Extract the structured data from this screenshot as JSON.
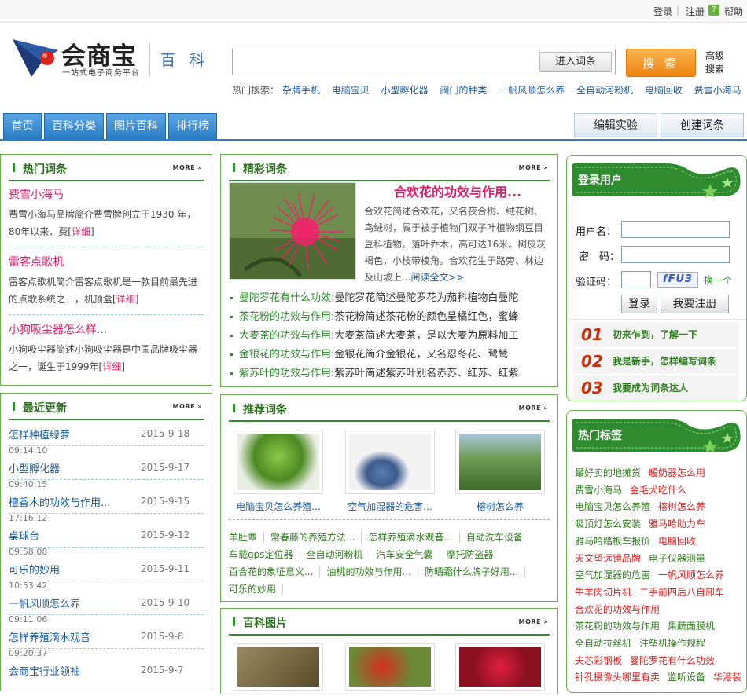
{
  "topbar": {
    "login": "登录",
    "register": "注册",
    "help": "帮助"
  },
  "logo": {
    "name": "会商宝",
    "slogan": "一站式电子商务平台",
    "section": "百 科"
  },
  "search": {
    "placeholder": "",
    "enter_label": "进入词条",
    "search_label": "搜 索",
    "advanced_label": "高级搜索"
  },
  "hot_search": {
    "label": "热门搜索：",
    "items": [
      "杂牌手机",
      "电脑宝贝",
      "小型孵化器",
      "阀门的种类",
      "一帆风顺怎么养",
      "全自动河粉机",
      "电脑回收",
      "费雪小海马"
    ]
  },
  "nav": {
    "tabs": [
      "首页",
      "百科分类",
      "图片百科",
      "排行榜"
    ],
    "right": [
      "编辑实验",
      "创建词条"
    ]
  },
  "more": "MORE",
  "hot_entries": {
    "title": "热门词条",
    "items": [
      {
        "title": "费雪小海马",
        "desc": "费雪小海马品牌简介费雪牌创立于1930 年，80年以来，费[",
        "detail": "详细",
        "tail": "]"
      },
      {
        "title": "雷客点歌机",
        "desc": "雷客点歌机简介雷客点歌机是一款目前最先进的点歌系统之一，机顶盒[",
        "detail": "详细",
        "tail": "]"
      },
      {
        "title": "小狗吸尘器怎么样...",
        "desc": "小狗吸尘器简述小狗吸尘器是中国品牌吸尘器之一，诞生于1999年[",
        "detail": "详细",
        "tail": "]"
      }
    ]
  },
  "recent": {
    "title": "最近更新",
    "items": [
      {
        "title": "怎样种植绿萝",
        "date": "2015-9-18",
        "time": ""
      },
      {
        "title": "小型孵化器",
        "date": "2015-9-17",
        "time": "09:14:10"
      },
      {
        "title": "檀香木的功效与作用...",
        "date": "2015-9-15",
        "time": "09:40:15"
      },
      {
        "title": "桌球台",
        "date": "2015-9-12",
        "time": "17:16:12"
      },
      {
        "title": "可乐的妙用",
        "date": "2015-9-11",
        "time": "09:58:08"
      },
      {
        "title": "一帆风顺怎么养",
        "date": "2015-9-10",
        "time": "10:53:42"
      },
      {
        "title": "怎样养殖滴水观音",
        "date": "2015-9-8",
        "time": "09:11:06"
      },
      {
        "title": "会商宝行业领袖",
        "date": "2015-9-7",
        "time": "09:20:37"
      }
    ]
  },
  "featured": {
    "title": "精彩词条",
    "main_title": "合欢花的功效与作用...",
    "main_desc": "合欢花简述合欢花，又名夜合树、绒花树、鸟绒树，属于被子植物门双子叶植物纲豆目豆科植物。落叶乔木，高可达16米。树皮灰褐色，小枝带棱角。合欢花生于路旁、林边及山坡上...",
    "read_more": "阅读全文>>",
    "list": [
      {
        "k": "曼陀罗花有什么功效",
        "v": "曼陀罗花简述曼陀罗花为茄科植物白曼陀"
      },
      {
        "k": "茶花粉的功效与作用",
        "v": "茶花粉简述茶花粉的颜色呈橘红色，蜜蜂"
      },
      {
        "k": "大麦茶的功效与作用",
        "v": "大麦茶简述大麦茶，是以大麦为原料加工"
      },
      {
        "k": "金银花的功效与作用",
        "v": "金银花简介金银花，又名忍冬花、鹭鸶"
      },
      {
        "k": "紫苏叶的功效与作用",
        "v": "紫苏叶简述紫苏叶别名赤苏、红苏、红紫"
      }
    ]
  },
  "recommend": {
    "title": "推荐词条",
    "cards": [
      "电脑宝贝怎么养殖...",
      "空气加湿器的危害...",
      "榕树怎么养"
    ],
    "tags": [
      [
        "羊肚蕈",
        "常春藤的养殖方法...",
        "怎样养殖滴水观音...",
        "自动洗车设备"
      ],
      [
        "车载gps定位器",
        "全自动河粉机",
        "汽车安全气囊",
        "摩托防盗器"
      ],
      [
        "百合花的象征意义...",
        "油桃的功效与作用...",
        "防晒霜什么牌子好用..."
      ],
      [
        "可乐的妙用"
      ]
    ]
  },
  "pictures": {
    "title": "百科图片"
  },
  "login_box": {
    "title": "登录用户",
    "username_label": "用户名：",
    "password_label": "密　码：",
    "captcha_label": "验证码：",
    "captcha_text": "fFU3",
    "refresh_label": "换一个",
    "login_button": "登录",
    "register_button": "我要注册",
    "steps": [
      {
        "no": "01",
        "text": "初来乍到，了解一下"
      },
      {
        "no": "02",
        "text": "我是新手，怎样编写词条"
      },
      {
        "no": "03",
        "text": "我要成为词条达人"
      }
    ]
  },
  "hot_tags": {
    "title": "热门标签",
    "rows": [
      [
        {
          "t": "最好卖的地摊货",
          "c": "g"
        },
        {
          "t": "暖奶器怎么用",
          "c": "r"
        }
      ],
      [
        {
          "t": "费雪小海马",
          "c": "g"
        },
        {
          "t": "金毛犬吃什么",
          "c": "r"
        }
      ],
      [
        {
          "t": "电脑宝贝怎么养殖",
          "c": "g"
        },
        {
          "t": "榕树怎么养",
          "c": "r"
        }
      ],
      [
        {
          "t": "吸顶灯怎么安装",
          "c": "g"
        },
        {
          "t": "雅马哈助力车",
          "c": "r"
        }
      ],
      [
        {
          "t": "雅马哈踏板车报价",
          "c": "g"
        },
        {
          "t": "电脑回收",
          "c": "r"
        }
      ],
      [
        {
          "t": "天文望远镜品牌",
          "c": "r"
        },
        {
          "t": "电子仪器测量",
          "c": "g"
        }
      ],
      [
        {
          "t": "空气加湿器的危害",
          "c": "g"
        },
        {
          "t": "一帆风顺怎么养",
          "c": "r"
        }
      ],
      [
        {
          "t": "牛羊肉切片机",
          "c": "r"
        },
        {
          "t": "二手前四后八自卸车",
          "c": "r"
        }
      ],
      [
        {
          "t": "合欢花的功效与作用",
          "c": "r"
        }
      ],
      [
        {
          "t": "茶花粉的功效与作用",
          "c": "g"
        },
        {
          "t": "果蔬面膜机",
          "c": "g"
        }
      ],
      [
        {
          "t": "全自动拉丝机",
          "c": "g"
        },
        {
          "t": "注塑机操作规程",
          "c": "g"
        }
      ],
      [
        {
          "t": "夫芯彩钢板",
          "c": "r"
        },
        {
          "t": "曼陀罗花有什么功效",
          "c": "r"
        }
      ],
      [
        {
          "t": "针孔摄像头哪里有卖",
          "c": "r"
        },
        {
          "t": "监听设备",
          "c": "g"
        },
        {
          "t": "华港装",
          "c": "r"
        }
      ]
    ]
  },
  "colors": {
    "accent_green": "#2e8b2e",
    "link_blue": "#1a5a99",
    "hot_pink": "#d6216d",
    "nav_blue": "#2a7dc3",
    "tag_red": "#d62020",
    "tag_green": "#2e7d1e"
  }
}
